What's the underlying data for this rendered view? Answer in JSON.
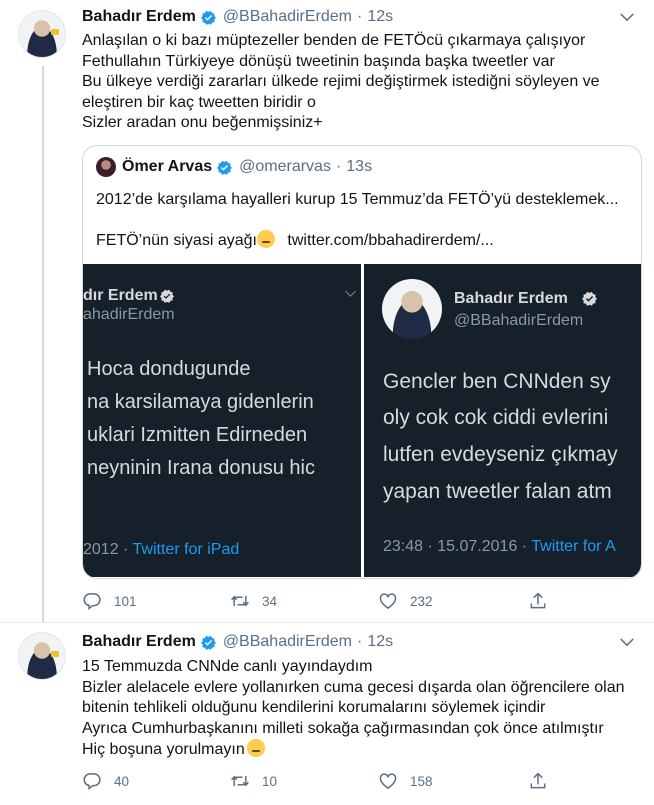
{
  "tweets": [
    {
      "author": {
        "name": "Bahadır Erdem",
        "handle": "@BBahadirErdem"
      },
      "dot": "·",
      "time": "12s",
      "lines": [
        "Anlaşılan o ki bazı müptezeller benden de FETÖcü çıkarmaya çalışıyor",
        "Fethullahın Türkiyeye dönüşü tweetinin başında başka tweetler var",
        "Bu ülkeye verdiği zararları ülkede rejimi değiştirmek istediğni söyleyen ve",
        "eleştiren bir kaç tweetten biridir o",
        "Sizler aradan onu beğenmişsiniz+"
      ],
      "quote": {
        "author": {
          "name": "Ömer Arvas",
          "handle": "@omerarvas"
        },
        "dot": "·",
        "time": "13s",
        "line1": "2012’de karşılama hayalleri kurup 15 Temmuz’da FETÖ’yü desteklemek...",
        "line2_text": "FETÖ’nün siyasi ayağı",
        "line2_link": "twitter.com/bbahadirerdem/...",
        "media_left": {
          "name": "dır Erdem",
          "handle": "ahadirErdem",
          "lines": [
            "Hoca dondugunde",
            "na karsilamaya gidenlerin",
            "uklari Izmitten Edirneden",
            "neyninin Irana donusu hic"
          ],
          "footer_date": "2012 ·",
          "footer_source": "Twitter for iPad"
        },
        "media_right": {
          "name": "Bahadır Erdem",
          "handle": "@BBahadirErdem",
          "lines": [
            "Gencler ben CNNden sy",
            "oly cok cok ciddi evlerini",
            "lutfen evdeyseniz çıkmay",
            "yapan tweetler falan atm"
          ],
          "footer_date": "23:48 · 15.07.2016 ·",
          "footer_source": "Twitter for A"
        }
      },
      "actions": {
        "reply": "101",
        "retweet": "34",
        "like": "232"
      }
    },
    {
      "author": {
        "name": "Bahadır Erdem",
        "handle": "@BBahadirErdem"
      },
      "dot": "·",
      "time": "12s",
      "lines": [
        "15 Temmuzda CNNde canlı yayındaydım",
        "Bizler alelacele evlere yollanırken cuma gecesi dışarda olan öğrencilere olan",
        "bitenin tehlikeli olduğunu kendilerini korumalarını söylemek içindir",
        "Ayrıca Cumhurbaşkanını milleti sokağa çağırmasından çok önce atılmıştır",
        "Hiç boşuna yorulmayın"
      ],
      "actions": {
        "reply": "40",
        "retweet": "10",
        "like": "158"
      }
    }
  ],
  "icons": {
    "verified": "verified-badge-icon",
    "caret": "chevron-down-icon",
    "reply": "reply-icon",
    "retweet": "retweet-icon",
    "like": "heart-icon",
    "share": "share-icon"
  },
  "colors": {
    "verified": "#1d9bf0",
    "text": "#0f1419",
    "muted": "#5b7083",
    "media_bg": "#15202b",
    "link": "#1d9bf0"
  }
}
